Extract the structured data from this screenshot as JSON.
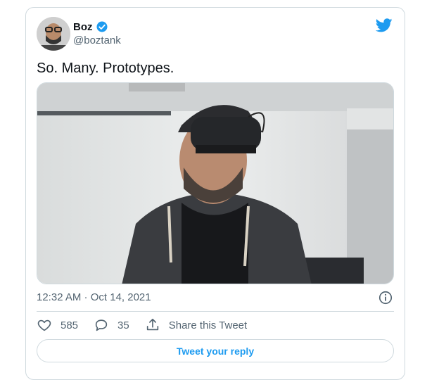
{
  "author": {
    "name": "Boz",
    "handle": "@boztank",
    "verified": true
  },
  "tweet": {
    "text": "So. Many. Prototypes.",
    "timestamp": "12:32 AM · Oct 14, 2021",
    "likes": "585",
    "replies": "35",
    "share_label": "Share this Tweet",
    "reply_button_label": "Tweet your reply"
  },
  "icons": {
    "brand": "twitter-bird-icon",
    "verified": "verified-badge-icon",
    "info": "info-icon",
    "like": "heart-icon",
    "reply": "reply-bubble-icon",
    "share": "share-icon"
  },
  "colors": {
    "accent": "#1d9bf0",
    "text": "#0f1419",
    "muted": "#536471",
    "border": "#cfd9de"
  }
}
